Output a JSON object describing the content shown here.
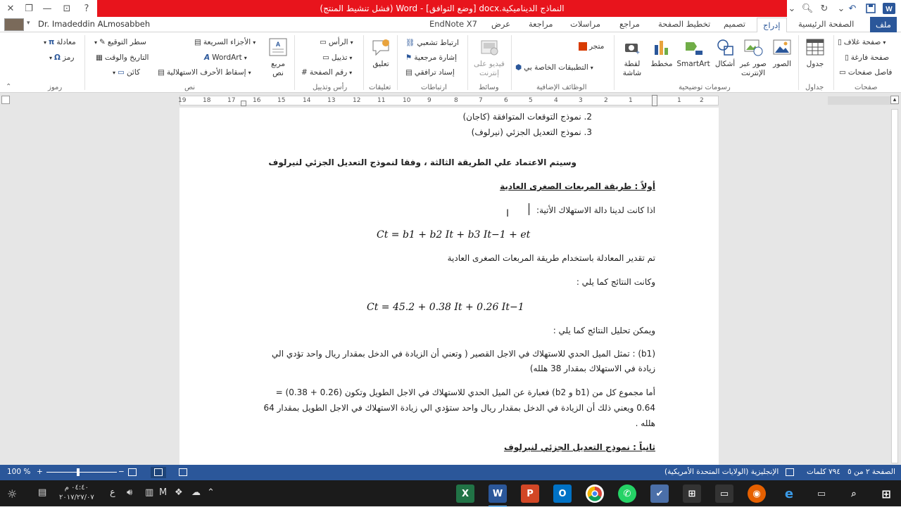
{
  "window": {
    "title": "النماذج الديناميكية.docx [وضع التوافق] - Word (فشل تنشيط المنتج)",
    "user_name": "Dr. Imadeddin ALmosabbeh",
    "help": "?"
  },
  "tabs": [
    "ملف",
    "الصفحة الرئيسية",
    "إدراج",
    "تصميم",
    "تخطيط الصفحة",
    "مراجع",
    "مراسلات",
    "مراجعة",
    "عرض",
    "EndNote X7"
  ],
  "active_tab": "إدراج",
  "ribbon": {
    "pages": {
      "label": "صفحات",
      "items": [
        "صفحة غلاف",
        "صفحة فارغة",
        "فاصل صفحات"
      ]
    },
    "tables": {
      "label": "جداول",
      "button": "جدول"
    },
    "illustrations": {
      "label": "رسومات توضيحية",
      "buttons": [
        "الصور",
        "صور عبر الإنترنت",
        "أشكال",
        "SmartArt",
        "مخطط",
        "لقطة شاشة"
      ]
    },
    "addins": {
      "label": "الوظائف الإضافية",
      "items": [
        "متجر",
        "التطبيقات الخاصة بي"
      ]
    },
    "media": {
      "label": "وسائط",
      "button": "فيديو على إنترنت"
    },
    "links": {
      "label": "ارتباطات",
      "items": [
        "ارتباط تشعبي",
        "إشارة مرجعية",
        "إسناد ترافقي"
      ]
    },
    "comments": {
      "label": "تعليقات",
      "button": "تعليق"
    },
    "header_footer": {
      "label": "رأس وتذييل",
      "items": [
        "الرأس",
        "تذييل",
        "رقم الصفحة"
      ]
    },
    "text": {
      "label": "نص",
      "button": "مربع نص",
      "items": [
        "الأجزاء السريعة",
        "WordArt",
        "إسقاط الأحرف الاستهلالية",
        "سطر التوقيع",
        "التاريخ والوقت",
        "كائن"
      ]
    },
    "symbols": {
      "label": "رموز",
      "items": [
        "معادلة",
        "رمز"
      ]
    }
  },
  "ruler": [
    "2",
    "1",
    "1",
    "2",
    "3",
    "4",
    "5",
    "6",
    "7",
    "8",
    "9",
    "10",
    "11",
    "12",
    "13",
    "14",
    "15",
    "16",
    "17",
    "18",
    "19"
  ],
  "document": {
    "list_2": "2.   نموذج التوقعات المتوافقة (كاجان)",
    "list_3": "3.   نموذج التعديل الجزئي (نيرلوف)",
    "heading_main": "وسيتم الاعتماد علي الطريقة الثالثة ، وفقا لنموذج التعديل الجزئي لنيرلوف",
    "heading_ols": "أولاً :  طريقة المربعات الصغرى العادية",
    "para_1": "اذا كانت لدينا دالة الاستهلاك الأتية:",
    "eq_1": "Ct = b1 + b2 It + b3 It−1 + et",
    "para_2": "تم تقدير المعادلة باستخدام طريقة المربعات الصغرى العادية",
    "para_3": "وكانت النتائج كما يلي :",
    "eq_2": "Ct = 45.2 + 0.38 It + 0.26 It−1",
    "para_4": "ويمكن تحليل النتائج كما يلي :",
    "para_5a": "(b1) : تمثل الميل الحدي للاستهلاك في الاجل القصير ( وتعني أن الزيادة في الدخل بمقدار ريال واحد تؤدي الي",
    "para_5b": "زيادة في الاستهلاك بمقدار 38 هلله)",
    "para_6a": "أما مجموع كل من (b1 و b2)  فعبارة عن الميل الحدي للاستهلاك في الاجل الطويل وتكون (0.26 + 0.38) =",
    "para_6b": "0.64  ويعني ذلك أن الزيادة في الدخل بمقدار ريال واحد ستؤدي الي زيادة الاستهلاك في الاجل الطويل بمقدار  64",
    "para_6c": "هلله .",
    "heading_2": "ثانياً : نموذج التعديل الجزئي لنيرلوف"
  },
  "status": {
    "page": "الصفحة ٢ من ٥",
    "words": "٧٩٤ كلمات",
    "language": "الإنجليزية (الولايات المتحدة الأمريكية)",
    "zoom": "100 %"
  },
  "taskbar": {
    "time": "٠٤:٤٠ م",
    "date": "٢٠١٧/٢٧/٠٧",
    "lang": "ع"
  },
  "colors": {
    "accent": "#2b579a",
    "titlebar_red": "#e8141c"
  }
}
